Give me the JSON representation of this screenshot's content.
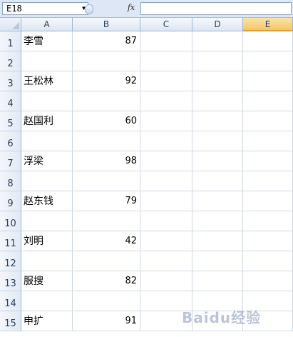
{
  "formula_bar": {
    "name_box": "E18",
    "fx_label": "fx",
    "formula": ""
  },
  "columns": [
    "A",
    "B",
    "C",
    "D",
    "E"
  ],
  "active_column": "E",
  "rows": [
    {
      "num": "1",
      "a": "李雪",
      "b": "87"
    },
    {
      "num": "2",
      "a": "",
      "b": ""
    },
    {
      "num": "3",
      "a": "王松林",
      "b": "92"
    },
    {
      "num": "4",
      "a": "",
      "b": ""
    },
    {
      "num": "5",
      "a": "赵国利",
      "b": "60"
    },
    {
      "num": "6",
      "a": "",
      "b": ""
    },
    {
      "num": "7",
      "a": "浮梁",
      "b": "98"
    },
    {
      "num": "8",
      "a": "",
      "b": ""
    },
    {
      "num": "9",
      "a": "赵东钱",
      "b": "79"
    },
    {
      "num": "10",
      "a": "",
      "b": ""
    },
    {
      "num": "11",
      "a": "刘明",
      "b": "42"
    },
    {
      "num": "12",
      "a": "",
      "b": ""
    },
    {
      "num": "13",
      "a": "服搜",
      "b": "82"
    },
    {
      "num": "14",
      "a": "",
      "b": ""
    },
    {
      "num": "15",
      "a": "申扩",
      "b": "91"
    }
  ],
  "watermark": "Baidu经验"
}
